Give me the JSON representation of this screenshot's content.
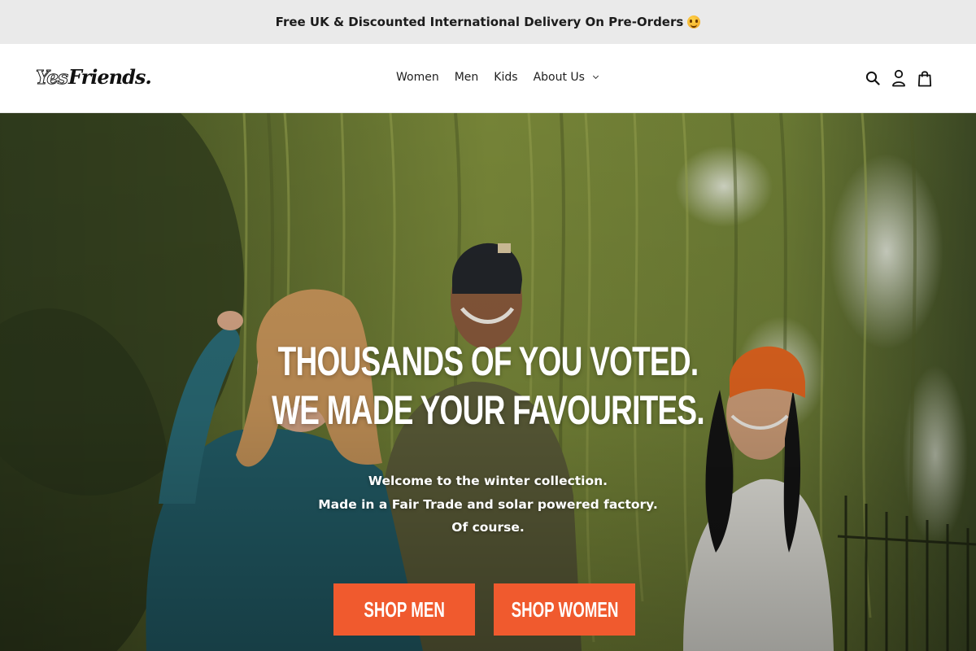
{
  "announcement": {
    "text": "Free UK & Discounted International Delivery On Pre-Orders",
    "emoji_icon": "star-struck-emoji-icon"
  },
  "header": {
    "logo_part1": "Yes",
    "logo_part2": "Friends.",
    "nav": [
      {
        "label": "Women"
      },
      {
        "label": "Men"
      },
      {
        "label": "Kids"
      },
      {
        "label": "About Us",
        "has_dropdown": true
      }
    ],
    "icons": [
      "search-icon",
      "account-icon",
      "cart-icon"
    ]
  },
  "hero": {
    "headline_line1": "THOUSANDS OF YOU VOTED.",
    "headline_line2": "WE MADE YOUR FAVOURITES.",
    "sub_line1": "Welcome to the winter collection.",
    "sub_line2": "Made in a Fair Trade and solar powered factory.",
    "sub_line3": "Of course.",
    "cta_primary": "SHOP MEN",
    "cta_secondary": "SHOP WOMEN"
  },
  "colors": {
    "announcement_bg": "#eaeaea",
    "cta_bg": "#f05a2e",
    "foliage": "#6d7a33"
  }
}
